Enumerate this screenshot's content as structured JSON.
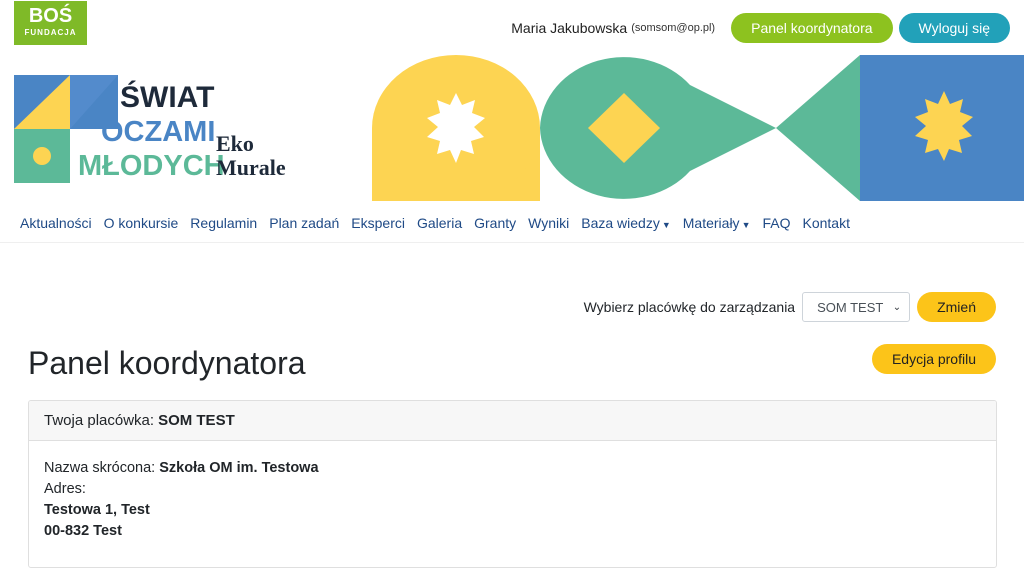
{
  "header": {
    "bos_logo": {
      "top": "BOŚ",
      "bottom": "FUNDACJA"
    },
    "user_name": "Maria Jakubowska",
    "user_email": "(somsom@op.pl)",
    "coordinator_panel_label": "Panel koordynatora",
    "logout_label": "Wyloguj się"
  },
  "brand": {
    "logo_lines": [
      "ŚWIAT",
      "OCZAMI",
      "MŁODYCH"
    ],
    "sub_lines": [
      "Eko",
      "Murale"
    ]
  },
  "nav": {
    "items": [
      {
        "label": "Aktualności"
      },
      {
        "label": "O konkursie"
      },
      {
        "label": "Regulamin"
      },
      {
        "label": "Plan zadań"
      },
      {
        "label": "Eksperci"
      },
      {
        "label": "Galeria"
      },
      {
        "label": "Granty"
      },
      {
        "label": "Wyniki"
      },
      {
        "label": "Baza wiedzy",
        "dropdown": true
      },
      {
        "label": "Materiały",
        "dropdown": true
      },
      {
        "label": "FAQ"
      },
      {
        "label": "Kontakt"
      }
    ]
  },
  "facility_select": {
    "label": "Wybierz placówkę do zarządzania",
    "selected": "SOM TEST",
    "change_label": "Zmień"
  },
  "page": {
    "title": "Panel koordynatora",
    "edit_profile_label": "Edycja profilu"
  },
  "card": {
    "header_label": "Twoja placówka:",
    "header_value": "SOM TEST",
    "short_name_label": "Nazwa skrócona:",
    "short_name_value": "Szkoła OM im. Testowa",
    "address_label": "Adres:",
    "address_line1": "Testowa 1, Test",
    "address_line2": "00-832 Test"
  },
  "colors": {
    "green": "#8dc21f",
    "teal": "#22a1b9",
    "yellow": "#fcc419",
    "nav_text": "#1f4a86",
    "art_yellow": "#fdd452",
    "art_green": "#5cb998",
    "art_blue": "#4a85c5"
  }
}
